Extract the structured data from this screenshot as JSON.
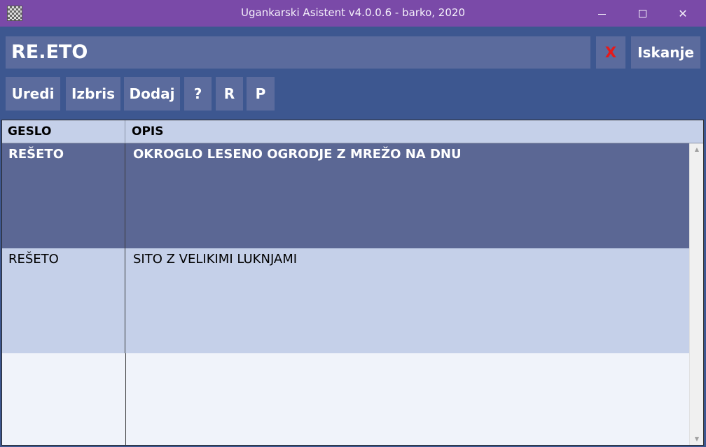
{
  "window": {
    "title": "Ugankarski Asistent v4.0.0.6 - barko, 2020",
    "minimize_glyph": "",
    "maximize_glyph": "",
    "close_glyph": "✕"
  },
  "search": {
    "value": "RE.ETO",
    "clear_label": "X",
    "search_label": "Iskanje"
  },
  "toolbar": {
    "edit_label": "Uredi",
    "delete_label": "Izbris",
    "add_label": "Dodaj",
    "help_label": "?",
    "r_label": "R",
    "p_label": "P"
  },
  "grid": {
    "columns": [
      "GESLO",
      "OPIS"
    ],
    "rows": [
      {
        "geslo": "REŠETO",
        "opis": "OKROGLO LESENO OGRODJE Z MREŽO NA DNU",
        "selected": true
      },
      {
        "geslo": "REŠETO",
        "opis": "SITO Z VELIKIMI LUKNJAMI",
        "selected": false
      }
    ]
  },
  "colors": {
    "titlebar": "#7a4aa8",
    "panel": "#3d5790",
    "button": "#5b6b9d",
    "selected_row": "#5b6794",
    "row": "#c5d0e9",
    "clear_x": "#e61a1a"
  },
  "icons": {
    "app": "app-icon",
    "minimize": "minimize-icon",
    "maximize": "maximize-icon",
    "close": "close-icon",
    "scroll_up": "scroll-up-icon",
    "scroll_down": "scroll-down-icon"
  }
}
